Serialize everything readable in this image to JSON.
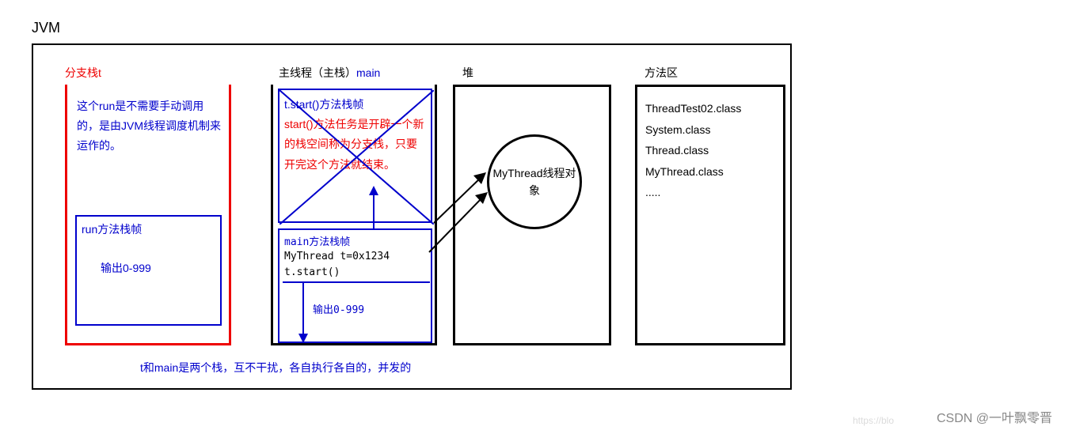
{
  "title": "JVM",
  "labels": {
    "branch_stack": "分支栈t",
    "main_thread_prefix": "主线程（主栈）",
    "main_thread_name": "main",
    "heap": "堆",
    "method_area": "方法区"
  },
  "branch_note": "这个run是不需要手动调用的，是由JVM线程调度机制来运作的。",
  "run_frame": {
    "title": "run方法栈帧",
    "output": "输出0-999"
  },
  "start_frame": {
    "line1": "t.start()方法栈帧",
    "body": "start()方法任务是开辟一个新的栈空间称为分支栈，只要开完这个方法就结束。"
  },
  "main_frame": {
    "title": "main方法栈帧",
    "line1": "MyThread t=0x1234",
    "line2": "t.start()",
    "output": "输出0-999"
  },
  "heap_object": "MyThread线程对象",
  "method_area": [
    "ThreadTest02.class",
    "System.class",
    "Thread.class",
    "MyThread.class",
    "....."
  ],
  "footer": "t和main是两个栈，互不干扰，各自执行各自的，并发的",
  "watermark1": "https://blo",
  "watermark2": "CSDN @一叶飘零晋"
}
